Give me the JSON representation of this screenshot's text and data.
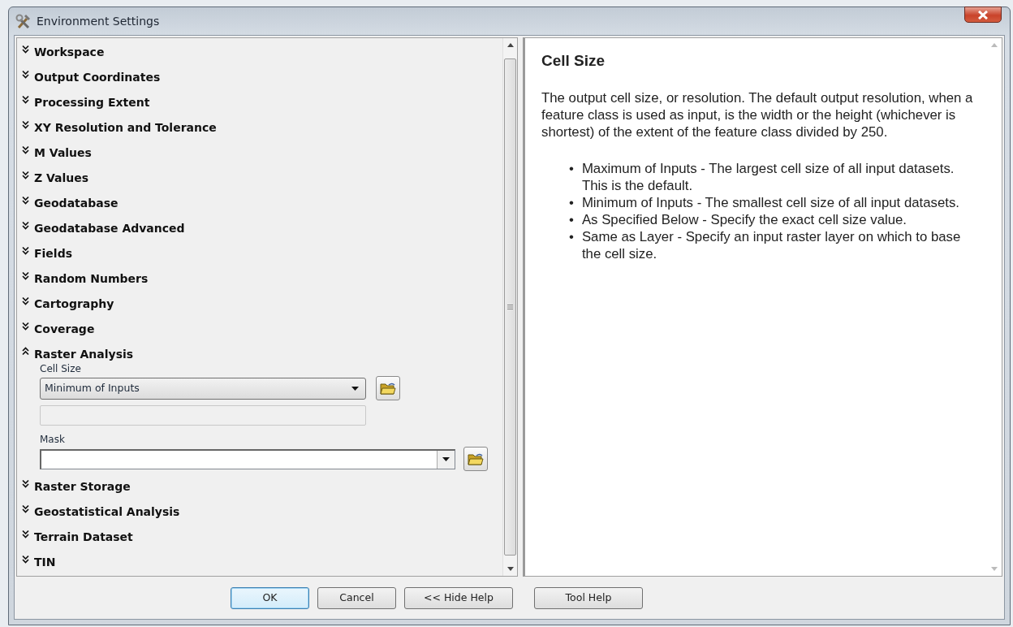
{
  "window": {
    "title": "Environment Settings"
  },
  "sections": [
    {
      "title": "Workspace",
      "expanded": false
    },
    {
      "title": "Output Coordinates",
      "expanded": false
    },
    {
      "title": "Processing Extent",
      "expanded": false
    },
    {
      "title": "XY Resolution and Tolerance",
      "expanded": false
    },
    {
      "title": "M Values",
      "expanded": false
    },
    {
      "title": "Z Values",
      "expanded": false
    },
    {
      "title": "Geodatabase",
      "expanded": false
    },
    {
      "title": "Geodatabase Advanced",
      "expanded": false
    },
    {
      "title": "Fields",
      "expanded": false
    },
    {
      "title": "Random Numbers",
      "expanded": false
    },
    {
      "title": "Cartography",
      "expanded": false
    },
    {
      "title": "Coverage",
      "expanded": false
    },
    {
      "title": "Raster Analysis",
      "expanded": true,
      "fields": [
        {
          "kind": "dropdown",
          "label": "Cell Size",
          "value": "Minimum of Inputs"
        },
        {
          "kind": "textbox",
          "disabled": true
        },
        {
          "kind": "combo",
          "label": "Mask"
        }
      ]
    },
    {
      "title": "Raster Storage",
      "expanded": false
    },
    {
      "title": "Geostatistical Analysis",
      "expanded": false
    },
    {
      "title": "Terrain Dataset",
      "expanded": false
    },
    {
      "title": "TIN",
      "expanded": false
    }
  ],
  "help": {
    "title": "Cell Size",
    "paragraph": "The output cell size, or resolution. The default output resolution, when a feature class is used as input, is the width or the height (whichever is shortest) of the extent of the feature class divided by 250.",
    "bullets": [
      {
        "marker": "•",
        "text": "Maximum of Inputs - The largest cell size of all input datasets. This is the default."
      },
      {
        "marker": "•",
        "text": "Minimum of Inputs - The smallest cell size of all input datasets."
      },
      {
        "marker": "•",
        "text": "As Specified Below - Specify the exact cell size value."
      },
      {
        "marker": "•",
        "text": "Same as Layer - Specify an input raster layer on which to base the cell size."
      }
    ]
  },
  "buttons": [
    {
      "label": "OK",
      "focused": true
    },
    {
      "label": "Cancel",
      "focused": false
    },
    {
      "label": "<< Hide Help",
      "focused": false
    },
    {
      "label": "Tool Help",
      "focused": false
    }
  ]
}
